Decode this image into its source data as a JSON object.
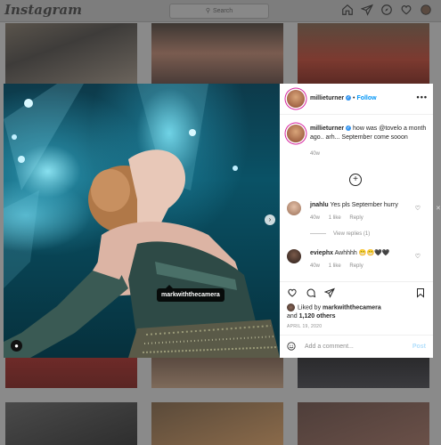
{
  "nav": {
    "logo": "Instagram",
    "search_placeholder": "Search"
  },
  "post": {
    "photo_tag": "markwiththecamera",
    "author": "millieturner",
    "follow_label": "Follow",
    "separator": "•",
    "more_label": "•••",
    "caption_text": "how was @tovelo a month ago.. arh... September come sooon",
    "caption_time": "40w",
    "load_more": "+",
    "comments": [
      {
        "user": "jnahlu",
        "text": "Yes pls September hurry",
        "time": "40w",
        "likes": "1 like",
        "reply": "Reply"
      },
      {
        "user": "eviephx",
        "text": "Awhhhh 😁😁🖤🖤",
        "time": "40w",
        "likes": "1 like",
        "reply": "Reply"
      }
    ],
    "view_replies": "View replies (1)",
    "liked_by_prefix": "Liked by",
    "liked_by_user": "markwiththecamera",
    "liked_by_and": "and",
    "liked_by_count": "1,120 others",
    "date": "APRIL 19, 2020",
    "add_comment_placeholder": "Add a comment...",
    "post_label": "Post"
  },
  "colors": {
    "accent": "#0095f6",
    "verified": "#3897f0"
  }
}
